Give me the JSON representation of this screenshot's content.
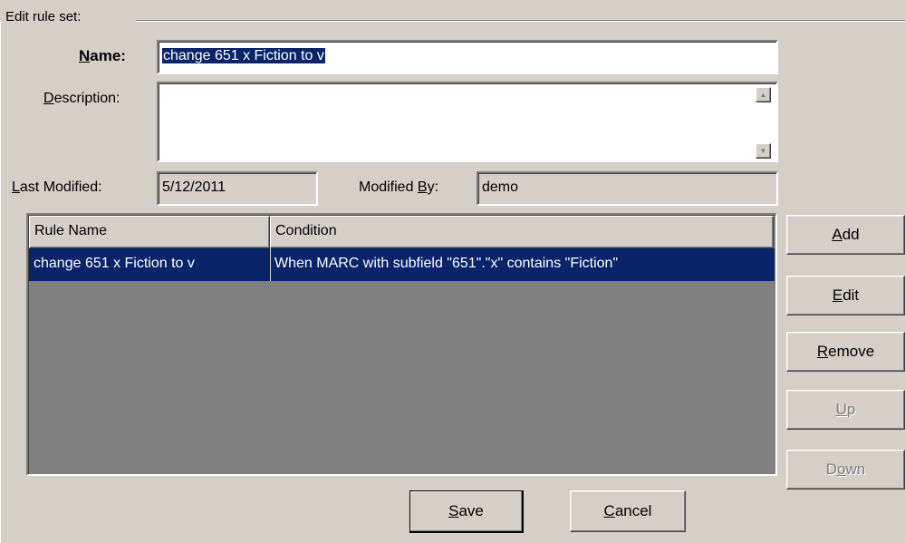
{
  "group": {
    "title": "Edit rule set:"
  },
  "name": {
    "mnemonic": "N",
    "rest": "ame:",
    "value": "change 651 x Fiction to v"
  },
  "description": {
    "mnemonic": "D",
    "rest": "escription:",
    "value": ""
  },
  "last_modified": {
    "mnemonic": "L",
    "rest": "ast Modified:",
    "value": "5/12/2011"
  },
  "modified_by": {
    "prefix": "Modified ",
    "mnemonic": "B",
    "rest": "y:",
    "value": "demo"
  },
  "rules_table": {
    "columns": [
      "Rule Name",
      "Condition"
    ],
    "rows": [
      {
        "rule_name": "change 651 x Fiction to v",
        "condition": "When MARC with subfield \"651\".\"x\" contains \"Fiction\"",
        "selected": true
      }
    ]
  },
  "side_buttons": {
    "add": {
      "mnemonic": "A",
      "rest": "dd",
      "enabled": true
    },
    "edit": {
      "mnemonic": "E",
      "rest": "dit",
      "enabled": true
    },
    "remove": {
      "mnemonic": "R",
      "rest": "emove",
      "enabled": true
    },
    "up": {
      "mnemonic": "U",
      "rest": "p",
      "enabled": false
    },
    "down": {
      "prefix": "D",
      "mnemonic": "o",
      "rest": "wn",
      "enabled": false
    }
  },
  "footer_buttons": {
    "save": {
      "mnemonic": "S",
      "rest": "ave"
    },
    "cancel": {
      "mnemonic": "C",
      "rest": "ancel"
    }
  },
  "colors": {
    "face": "#d4d0c8",
    "selection": "#0a246a",
    "list_bg": "#808080"
  }
}
